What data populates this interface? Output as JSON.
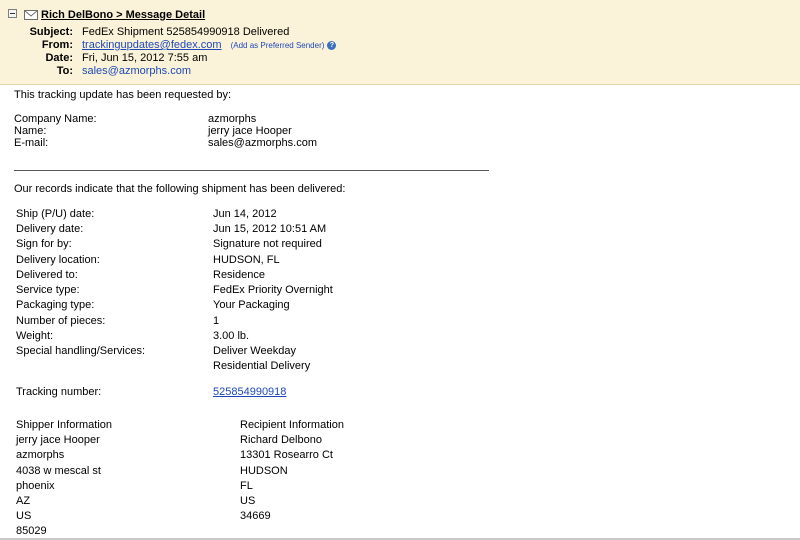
{
  "header": {
    "title": "Rich DelBono > Message Detail",
    "subject_label": "Subject:",
    "subject": "FedEx Shipment 525854990918 Delivered",
    "from_label": "From:",
    "from": "trackingupdates@fedex.com",
    "add_preferred": "(Add as Preferred Sender)",
    "date_label": "Date:",
    "date": "Fri, Jun 15, 2012 7:55 am",
    "to_label": "To:",
    "to": "sales@azmorphs.com"
  },
  "body": {
    "intro": "This tracking update has been requested by:",
    "requester": [
      {
        "label": "Company Name:",
        "value": "azmorphs"
      },
      {
        "label": "Name:",
        "value": "jerry jace Hooper"
      },
      {
        "label": "E-mail:",
        "value": "sales@azmorphs.com"
      }
    ],
    "records_intro": "Our records indicate that the following shipment has been delivered:",
    "details": [
      {
        "label": "Ship (P/U) date:",
        "value": "Jun 14, 2012"
      },
      {
        "label": "Delivery date:",
        "value": "Jun 15, 2012 10:51 AM"
      },
      {
        "label": "Sign for by:",
        "value": "Signature not required"
      },
      {
        "label": "Delivery location:",
        "value": "HUDSON, FL"
      },
      {
        "label": "Delivered to:",
        "value": "Residence"
      },
      {
        "label": "Service type:",
        "value": "FedEx Priority Overnight"
      },
      {
        "label": "Packaging type:",
        "value": "Your Packaging"
      },
      {
        "label": "Number of pieces:",
        "value": "1"
      },
      {
        "label": "Weight:",
        "value": "3.00 lb."
      },
      {
        "label": "Special handling/Services:",
        "value": "Deliver Weekday"
      },
      {
        "label": "",
        "value": "Residential Delivery"
      }
    ],
    "tracking_label": "Tracking number:",
    "tracking_number": "525854990918",
    "shipper": [
      "Shipper Information",
      "jerry jace Hooper",
      "azmorphs",
      "4038 w mescal st",
      "phoenix",
      "AZ",
      "US",
      "85029"
    ],
    "recipient": [
      "Recipient Information",
      "Richard Delbono",
      "13301 Rosearro Ct",
      "HUDSON",
      "FL",
      "US",
      "34669"
    ]
  }
}
